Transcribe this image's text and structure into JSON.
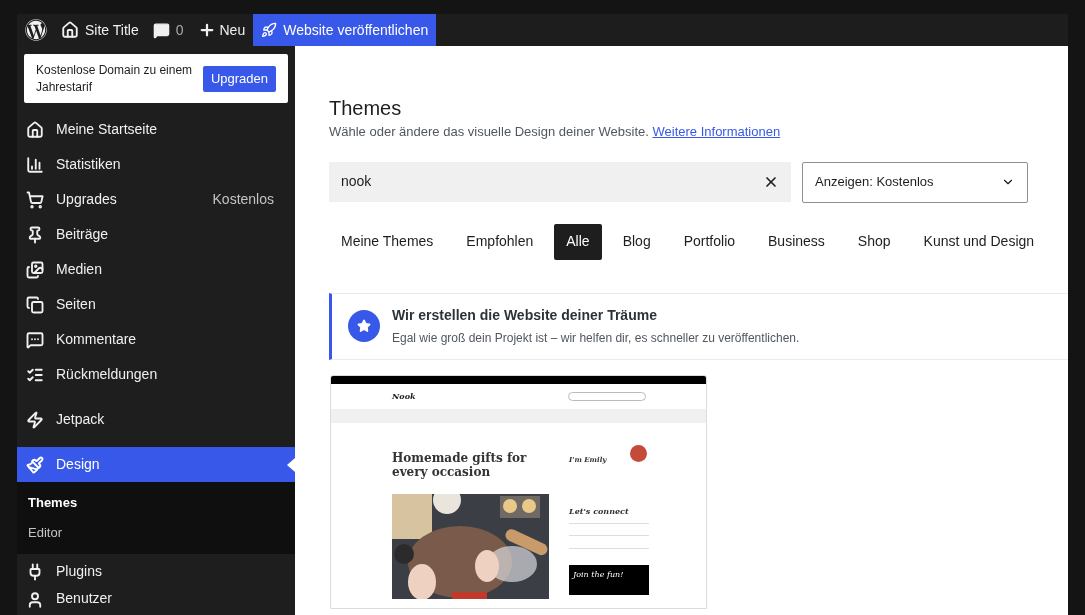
{
  "admin_bar": {
    "site_title": "Site Title",
    "comments_count": "0",
    "new_label": "Neu",
    "publish_button": "Website veröffentlichen"
  },
  "upgrade_notice": {
    "text": "Kostenlose Domain zu einem Jahrestarif",
    "button": "Upgraden"
  },
  "sidebar": {
    "items": [
      {
        "label": "Meine Startseite",
        "selected": false
      },
      {
        "label": "Statistiken",
        "selected": false
      },
      {
        "label": "Upgrades",
        "badge": "Kostenlos",
        "selected": false
      },
      {
        "label": "Beiträge",
        "selected": false
      },
      {
        "label": "Medien",
        "selected": false
      },
      {
        "label": "Seiten",
        "selected": false
      },
      {
        "label": "Kommentare",
        "selected": false
      },
      {
        "label": "Rückmeldungen",
        "selected": false
      },
      {
        "label": "Jetpack",
        "selected": false
      },
      {
        "label": "Design",
        "selected": true,
        "children": [
          {
            "label": "Themes",
            "selected": true
          },
          {
            "label": "Editor",
            "selected": false
          }
        ]
      },
      {
        "label": "Plugins",
        "selected": false
      },
      {
        "label": "Benutzer",
        "selected": false
      }
    ]
  },
  "page": {
    "title": "Themes",
    "subtitle": "Wähle oder ändere das visuelle Design deiner Website.",
    "subtitle_link": "Weitere Informationen"
  },
  "search": {
    "value": "nook"
  },
  "filter_dropdown": {
    "value": "Anzeigen: Kostenlos"
  },
  "tabs": [
    {
      "label": "Meine Themes",
      "selected": false
    },
    {
      "label": "Empfohlen",
      "selected": false
    },
    {
      "label": "Alle",
      "selected": true
    },
    {
      "label": "Blog",
      "selected": false
    },
    {
      "label": "Portfolio",
      "selected": false
    },
    {
      "label": "Business",
      "selected": false
    },
    {
      "label": "Shop",
      "selected": false
    },
    {
      "label": "Kunst und Design",
      "selected": false
    }
  ],
  "banner": {
    "title": "Wir erstellen die Website deiner Träume",
    "text": "Egal wie groß dein Projekt ist – wir helfen dir, es schneller zu veröffentlichen."
  },
  "theme_preview": {
    "site_name": "Nook",
    "headline": "Homemade gifts for every occasion",
    "author_heading": "I'm Emily",
    "connect_heading": "Let's connect",
    "join_heading": "Join the fun!"
  }
}
